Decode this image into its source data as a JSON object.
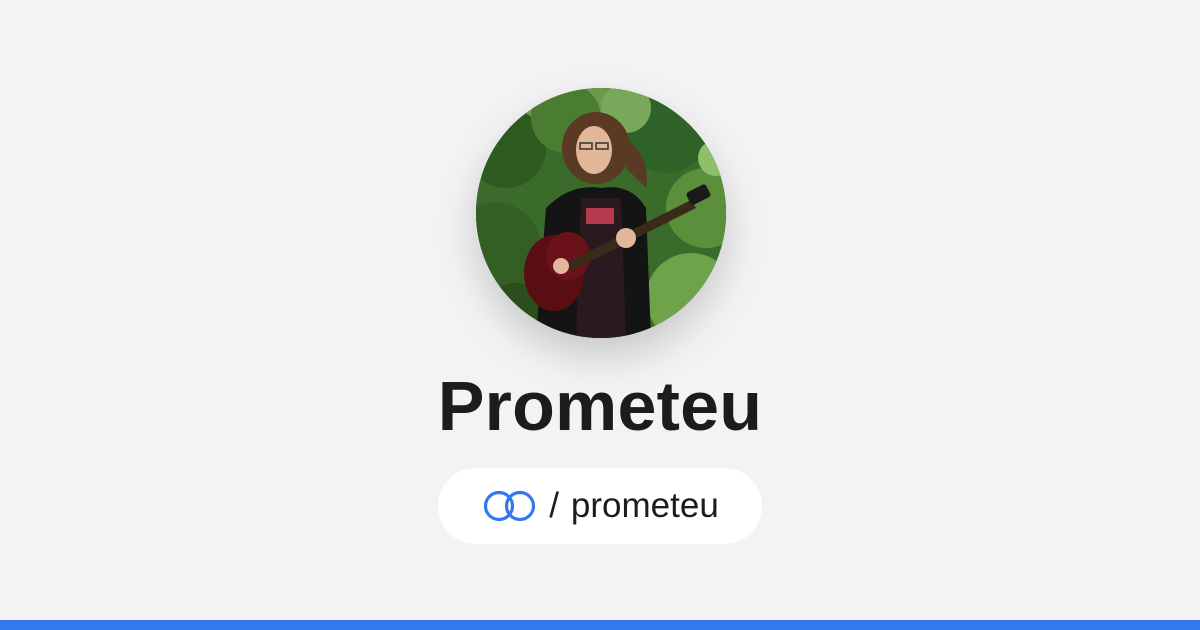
{
  "profile": {
    "display_name": "Prometeu",
    "avatar_icon": "profile-photo"
  },
  "handle": {
    "separator": "/",
    "username": "prometeu",
    "logo_icon": "linked-rings-icon"
  },
  "colors": {
    "background": "#f3f3f5",
    "accent": "#3478f0",
    "text": "#1c1c1f"
  }
}
